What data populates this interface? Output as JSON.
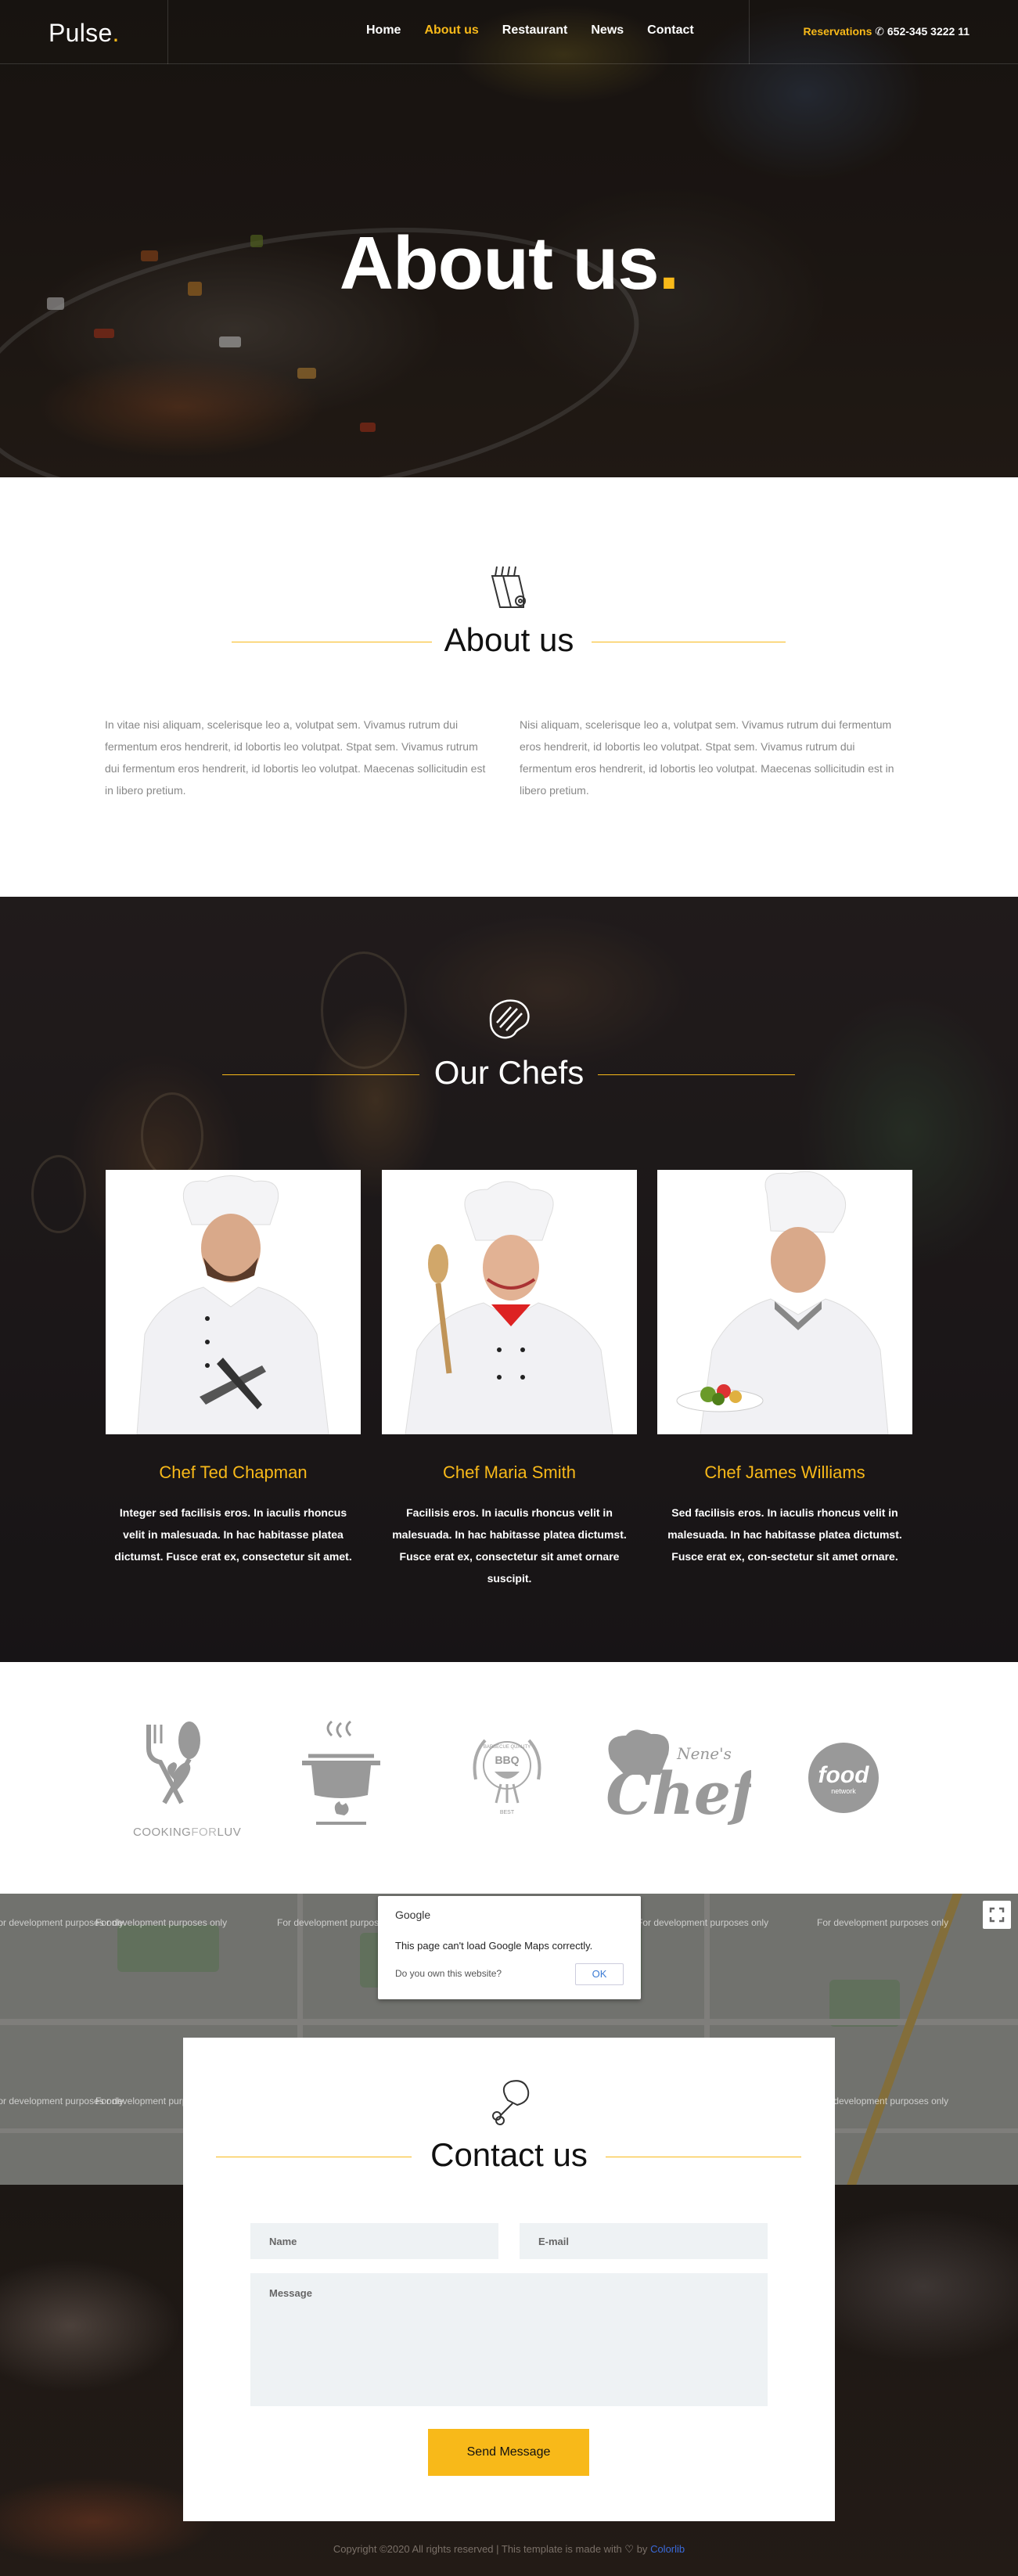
{
  "brand": {
    "name": "Pulse",
    "dot": "."
  },
  "nav": {
    "items": [
      {
        "label": "Home",
        "active": false
      },
      {
        "label": "About us",
        "active": true
      },
      {
        "label": "Restaurant",
        "active": false
      },
      {
        "label": "News",
        "active": false
      },
      {
        "label": "Contact",
        "active": false
      }
    ]
  },
  "reservations": {
    "label": "Reservations",
    "phone": "652-345 3222 11",
    "icon": "phone-icon"
  },
  "hero": {
    "title": "About us",
    "dot": "."
  },
  "about": {
    "icon": "knife-block-icon",
    "title": "About us",
    "col1": "In vitae nisi aliquam, scelerisque leo a, volutpat sem. Vivamus rutrum dui fermentum eros hendrerit, id lobortis leo volutpat. Stpat sem. Vivamus rutrum dui fermentum eros hendrerit, id lobortis leo volutpat. Maecenas sollicitudin est in libero pretium.",
    "col2": "Nisi aliquam, scelerisque leo a, volutpat sem. Vivamus rutrum dui fermentum eros hendrerit, id lobortis leo volutpat. Stpat sem. Vivamus rutrum dui fermentum eros hendrerit, id lobortis leo volutpat. Maecenas sollicitudin est in libero pretium."
  },
  "chefs": {
    "icon": "steak-icon",
    "title": "Our Chefs",
    "items": [
      {
        "name": "Chef Ted Chapman",
        "desc": "Integer sed facilisis eros. In iaculis rhoncus velit in malesuada. In hac habitasse platea dictumst. Fusce erat ex, consectetur sit amet."
      },
      {
        "name": "Chef Maria Smith",
        "desc": "Facilisis eros. In iaculis rhoncus velit in malesuada. In hac habitasse platea dictumst. Fusce erat ex, consectetur sit amet ornare suscipit."
      },
      {
        "name": "Chef James Williams",
        "desc": "Sed facilisis eros. In iaculis rhoncus velit in malesuada. In hac habitasse platea dictumst. Fusce erat ex, con-sectetur sit amet ornare."
      }
    ]
  },
  "logos": {
    "cooking": {
      "part1": "COOKING",
      "part2": "FOR",
      "part3": "LUV"
    },
    "bbq": {
      "top": "BARBECUE QUALITY",
      "mid": "BBQ",
      "bottom": "BEST"
    },
    "nenes": {
      "small": "Nene's",
      "big": "Chef"
    },
    "food": {
      "big": "food",
      "small": "network"
    }
  },
  "map": {
    "dev_text": "For development purposes only",
    "dialog": {
      "brand": "Google",
      "message": "This page can't load Google Maps correctly.",
      "question": "Do you own this website?",
      "ok": "OK"
    }
  },
  "contact": {
    "icon": "chicken-leg-icon",
    "title": "Contact us",
    "name_placeholder": "Name",
    "email_placeholder": "E-mail",
    "message_placeholder": "Message",
    "send": "Send Message"
  },
  "footer": {
    "copyright": "Copyright ©2020 All rights reserved | This template is made with",
    "by": "by",
    "link": "Colorlib"
  },
  "colors": {
    "accent": "#f8b919",
    "link": "#3b6ad9"
  }
}
